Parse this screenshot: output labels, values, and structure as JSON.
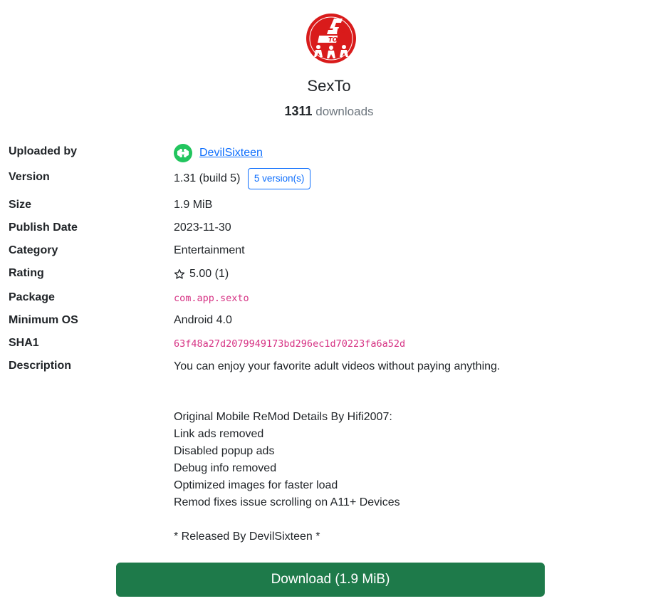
{
  "app": {
    "title": "SexTo",
    "downloads_count": "1311",
    "downloads_label": "downloads",
    "icon": "app-logo-icon",
    "icon_color": "#d91b1b"
  },
  "details": {
    "uploaded_by_label": "Uploaded by",
    "uploader_name": "DevilSixteen",
    "uploader_avatar_color": "#22c55e",
    "version_label": "Version",
    "version_value": "1.31 (build 5)",
    "versions_button": "5 version(s)",
    "size_label": "Size",
    "size_value": "1.9 MiB",
    "publish_date_label": "Publish Date",
    "publish_date_value": "2023-11-30",
    "category_label": "Category",
    "category_value": "Entertainment",
    "rating_label": "Rating",
    "rating_value": "5.00 (1)",
    "package_label": "Package",
    "package_value": "com.app.sexto",
    "min_os_label": "Minimum OS",
    "min_os_value": "Android 4.0",
    "sha1_label": "SHA1",
    "sha1_value": "63f48a27d2079949173bd296ec1d70223fa6a52d",
    "description_label": "Description",
    "description_lines": [
      "You can enjoy your favorite adult videos without paying anything.",
      "Original Mobile ReMod Details By Hifi2007:",
      "Link ads removed",
      "Disabled popup ads",
      "Debug info removed",
      "Optimized images for faster load",
      "Remod fixes issue scrolling on A11+ Devices",
      "* Released By DevilSixteen *"
    ]
  },
  "download_button": "Download (1.9 MiB)",
  "colors": {
    "accent": "#0d6efd",
    "mono": "#d63384",
    "download": "#1e7a4a"
  }
}
